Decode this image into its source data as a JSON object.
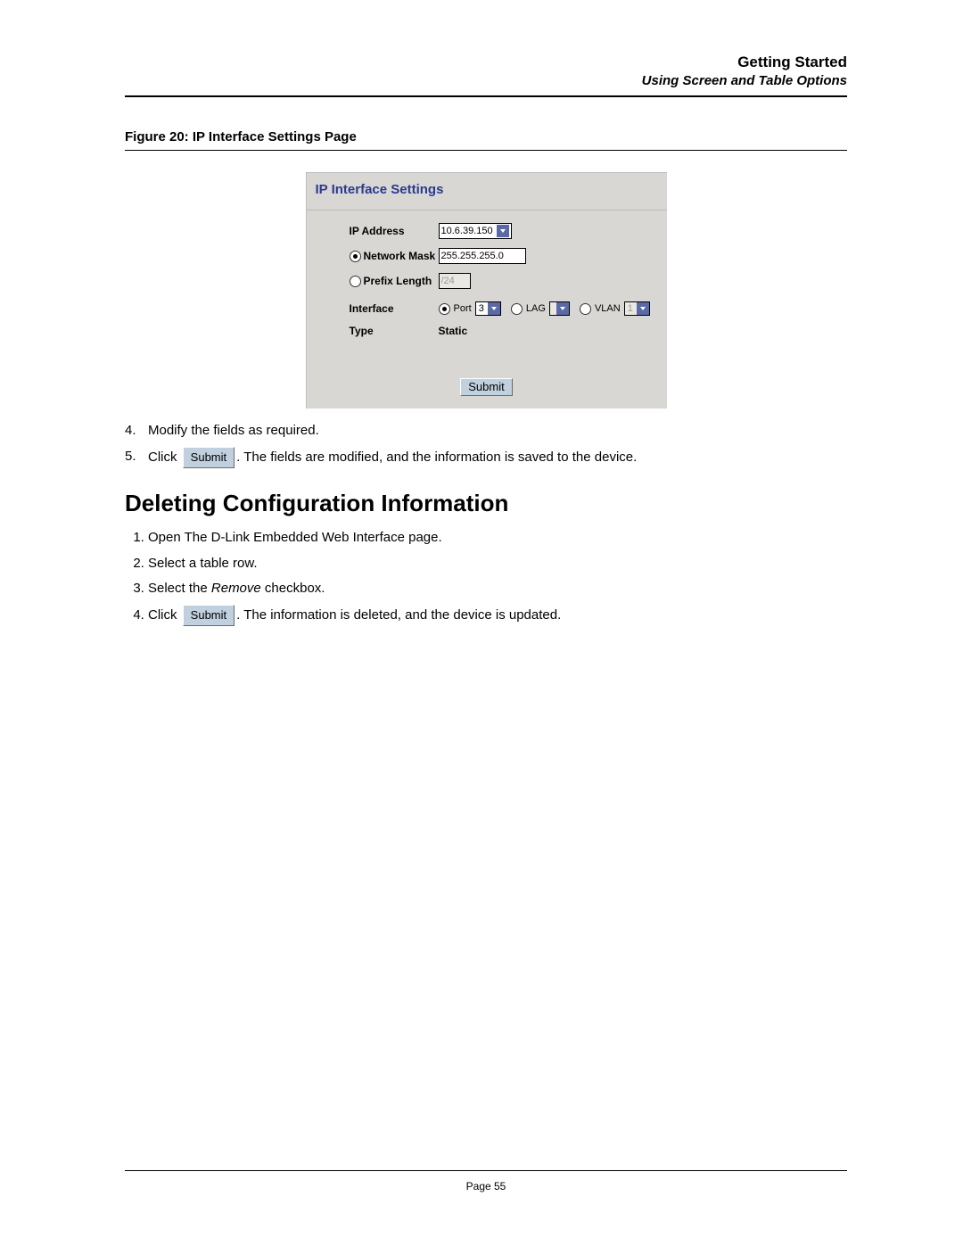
{
  "header": {
    "title": "Getting Started",
    "subtitle": "Using Screen and Table Options"
  },
  "figure_caption": "Figure 20:  IP Interface Settings Page",
  "panel": {
    "title": "IP Interface Settings",
    "rows": {
      "ip_address": {
        "label": "IP Address",
        "value": "10.6.39.150"
      },
      "network_mask": {
        "label": "Network Mask",
        "value": "255.255.255.0"
      },
      "prefix_length": {
        "label": "Prefix Length",
        "value": "/24"
      },
      "interface": {
        "label": "Interface",
        "port_label": "Port",
        "port_value": "3",
        "lag_label": "LAG",
        "lag_value": "",
        "vlan_label": "VLAN",
        "vlan_value": "1"
      },
      "type": {
        "label": "Type",
        "value": "Static"
      }
    },
    "submit": "Submit"
  },
  "steps_a": {
    "s4": "Modify the fields as required.",
    "s5_pre": "Click",
    "s5_btn": "Submit",
    "s5_post": ". The fields are modified, and the information is saved to the device."
  },
  "section_heading": "Deleting Configuration Information",
  "steps_b": {
    "s1": "Open The D-Link Embedded Web Interface page.",
    "s2": "Select a table row.",
    "s3_pre": "Select the ",
    "s3_em": "Remove",
    "s3_post": " checkbox.",
    "s4_pre": "Click",
    "s4_btn": "Submit",
    "s4_post": ". The information is deleted, and the device is updated."
  },
  "footer": {
    "page": "Page 55"
  }
}
